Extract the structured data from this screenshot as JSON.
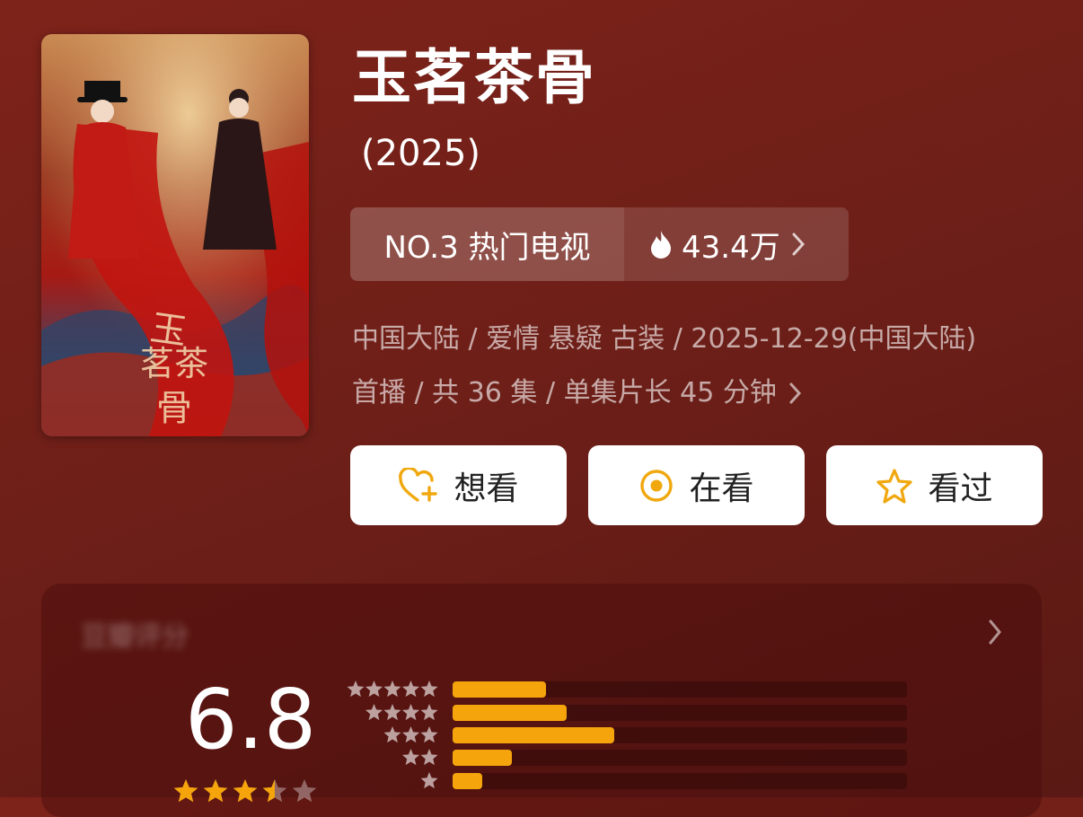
{
  "show": {
    "title": "玉茗茶骨",
    "year": "(2025)",
    "poster_calligraphy": "玉茗茶骨"
  },
  "rank": {
    "label": "NO.3 热门电视",
    "heat": "43.4万",
    "heat_icon": "flame-icon",
    "chevron_icon": "chevron-right-icon"
  },
  "meta": {
    "line1": "中国大陆 / 爱情 悬疑 古装 / 2025-12-29(中国大陆)",
    "line2": "首播 / 共 36 集 / 单集片长 45 分钟"
  },
  "actions": {
    "want": {
      "label": "想看",
      "icon": "heart-plus-icon"
    },
    "watching": {
      "label": "在看",
      "icon": "target-icon"
    },
    "watched": {
      "label": "看过",
      "icon": "star-outline-icon"
    }
  },
  "rating": {
    "title": "豆瓣评分",
    "score": "6.8",
    "stars_value": 3.5,
    "accent": "#f5a40c",
    "distribution": [
      {
        "stars": 5,
        "fraction": 0.205
      },
      {
        "stars": 4,
        "fraction": 0.25
      },
      {
        "stars": 3,
        "fraction": 0.355
      },
      {
        "stars": 2,
        "fraction": 0.13
      },
      {
        "stars": 1,
        "fraction": 0.065
      }
    ]
  }
}
